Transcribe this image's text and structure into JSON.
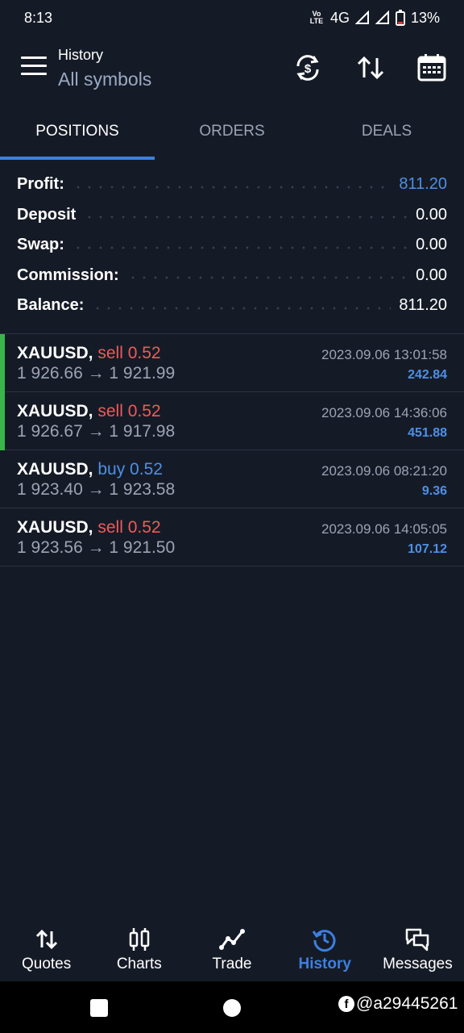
{
  "status": {
    "time": "8:13",
    "network": "4G",
    "battery": "13%"
  },
  "header": {
    "title": "History",
    "subtitle": "All symbols"
  },
  "tabs": [
    {
      "label": "POSITIONS",
      "active": true
    },
    {
      "label": "ORDERS",
      "active": false
    },
    {
      "label": "DEALS",
      "active": false
    }
  ],
  "summary": {
    "profit_label": "Profit:",
    "profit_value": "811.20",
    "deposit_label": "Deposit",
    "deposit_value": "0.00",
    "swap_label": "Swap:",
    "swap_value": "0.00",
    "commission_label": "Commission:",
    "commission_value": "0.00",
    "balance_label": "Balance:",
    "balance_value": "811.20"
  },
  "deals": [
    {
      "symbol": "XAUUSD,",
      "side": "sell 0.52",
      "type": "sell",
      "prices": "1 926.66 → 1 921.99",
      "time": "2023.09.06 13:01:58",
      "profit": "242.84",
      "accent": true
    },
    {
      "symbol": "XAUUSD,",
      "side": "sell 0.52",
      "type": "sell",
      "prices": "1 926.67 → 1 917.98",
      "time": "2023.09.06 14:36:06",
      "profit": "451.88",
      "accent": true
    },
    {
      "symbol": "XAUUSD,",
      "side": "buy 0.52",
      "type": "buy",
      "prices": "1 923.40 → 1 923.58",
      "time": "2023.09.06 08:21:20",
      "profit": "9.36",
      "accent": false
    },
    {
      "symbol": "XAUUSD,",
      "side": "sell 0.52",
      "type": "sell",
      "prices": "1 923.56 → 1 921.50",
      "time": "2023.09.06 14:05:05",
      "profit": "107.12",
      "accent": false
    }
  ],
  "nav": {
    "quotes": "Quotes",
    "charts": "Charts",
    "trade": "Trade",
    "history": "History",
    "messages": "Messages"
  },
  "colors": {
    "background": "#151b26",
    "accent_blue": "#3d7fe0",
    "sell_red": "#f05a5a",
    "profit_green_bar": "#39b54a"
  },
  "watermark": "@a29445261"
}
